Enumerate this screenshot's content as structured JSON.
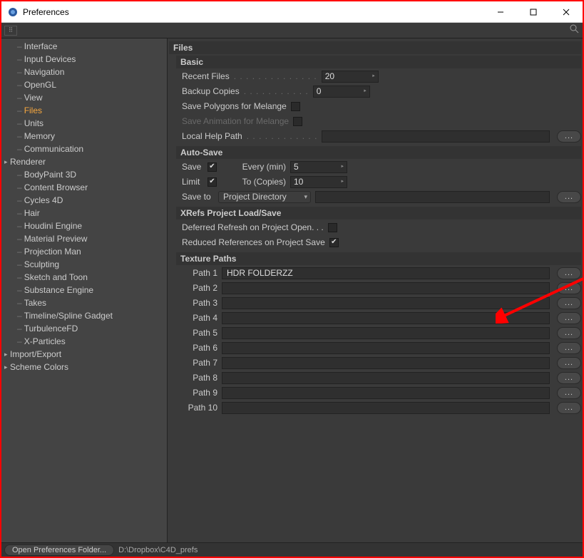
{
  "window": {
    "title": "Preferences"
  },
  "sidebar": {
    "items": [
      {
        "label": "Interface",
        "indent": true
      },
      {
        "label": "Input Devices",
        "indent": true
      },
      {
        "label": "Navigation",
        "indent": true
      },
      {
        "label": "OpenGL",
        "indent": true
      },
      {
        "label": "View",
        "indent": true
      },
      {
        "label": "Files",
        "indent": true,
        "active": true
      },
      {
        "label": "Units",
        "indent": true
      },
      {
        "label": "Memory",
        "indent": true
      },
      {
        "label": "Communication",
        "indent": true
      },
      {
        "label": "Renderer",
        "expandable": true
      },
      {
        "label": "BodyPaint 3D",
        "indent": true
      },
      {
        "label": "Content Browser",
        "indent": true
      },
      {
        "label": "Cycles 4D",
        "indent": true
      },
      {
        "label": "Hair",
        "indent": true
      },
      {
        "label": "Houdini Engine",
        "indent": true
      },
      {
        "label": "Material Preview",
        "indent": true
      },
      {
        "label": "Projection Man",
        "indent": true
      },
      {
        "label": "Sculpting",
        "indent": true
      },
      {
        "label": "Sketch and Toon",
        "indent": true
      },
      {
        "label": "Substance Engine",
        "indent": true
      },
      {
        "label": "Takes",
        "indent": true
      },
      {
        "label": "Timeline/Spline Gadget",
        "indent": true
      },
      {
        "label": "TurbulenceFD",
        "indent": true
      },
      {
        "label": "X-Particles",
        "indent": true
      },
      {
        "label": "Import/Export",
        "expandable": true
      },
      {
        "label": "Scheme Colors",
        "expandable": true
      }
    ]
  },
  "header": {
    "title": "Files"
  },
  "basic": {
    "title": "Basic",
    "recent_files_label": "Recent Files",
    "recent_files_value": "20",
    "backup_label": "Backup Copies",
    "backup_value": "0",
    "save_poly_label": "Save Polygons for Melange",
    "save_poly_checked": false,
    "save_anim_label": "Save Animation for Melange",
    "save_anim_checked": false,
    "help_label": "Local Help Path",
    "help_value": ""
  },
  "autosave": {
    "title": "Auto-Save",
    "save_label": "Save",
    "save_checked": true,
    "every_label": "Every (min)",
    "every_value": "5",
    "limit_label": "Limit",
    "limit_checked": true,
    "to_label": "To (Copies)",
    "to_value": "10",
    "saveto_label": "Save to",
    "saveto_value": "Project Directory",
    "saveto_path": ""
  },
  "xrefs": {
    "title": "XRefs Project Load/Save",
    "deferred_label": "Deferred Refresh on Project Open. . .",
    "deferred_checked": false,
    "reduced_label": "Reduced References on Project Save",
    "reduced_checked": true
  },
  "tex": {
    "title": "Texture Paths",
    "paths": [
      {
        "label": "Path 1",
        "value": "HDR FOLDERZZ"
      },
      {
        "label": "Path 2",
        "value": ""
      },
      {
        "label": "Path 3",
        "value": ""
      },
      {
        "label": "Path 4",
        "value": ""
      },
      {
        "label": "Path 5",
        "value": ""
      },
      {
        "label": "Path 6",
        "value": ""
      },
      {
        "label": "Path 7",
        "value": ""
      },
      {
        "label": "Path 8",
        "value": ""
      },
      {
        "label": "Path 9",
        "value": ""
      },
      {
        "label": "Path 10",
        "value": ""
      }
    ]
  },
  "status": {
    "button": "Open Preferences Folder...",
    "path": "D:\\Dropbox\\C4D_prefs"
  },
  "browse_label": "..."
}
